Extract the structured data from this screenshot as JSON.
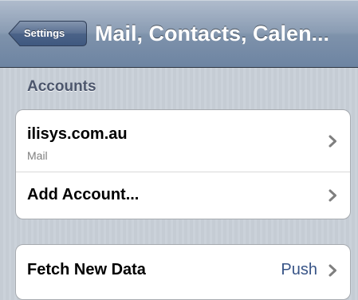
{
  "navbar": {
    "back_label": "Settings",
    "title": "Mail, Contacts, Calen..."
  },
  "accounts_section": {
    "header": "Accounts",
    "items": [
      {
        "title": "ilisys.com.au",
        "subtitle": "Mail",
        "icon": "chevron-right-icon"
      },
      {
        "title": "Add Account...",
        "icon": "chevron-right-icon"
      }
    ]
  },
  "fetch_section": {
    "items": [
      {
        "title": "Fetch New Data",
        "value": "Push",
        "icon": "chevron-right-icon"
      }
    ]
  },
  "colors": {
    "navbar_top": "#b0bccd",
    "navbar_bottom": "#6d84a2",
    "background": "#c5ccd4",
    "section_header": "#4c566c",
    "detail_value": "#385487",
    "chevron": "#7f7f7f"
  }
}
